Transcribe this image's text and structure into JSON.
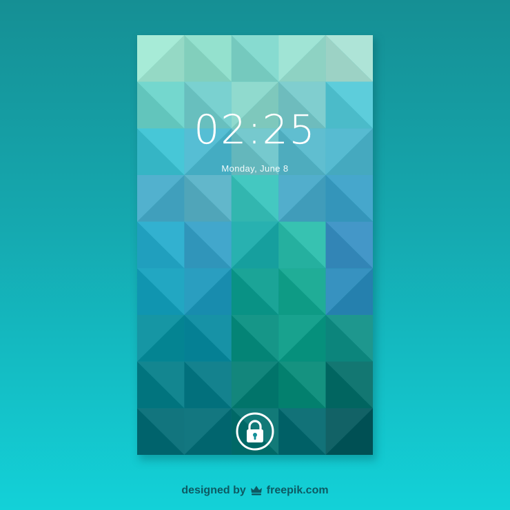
{
  "lock_screen": {
    "time": "02:25",
    "date": "Monday, June 8",
    "unlock_icon": "padlock-icon"
  },
  "credit": {
    "prefix": "designed by",
    "brand": "freepik.com",
    "brand_icon": "freepik-crown-icon"
  },
  "colors": {
    "background_top": "#158f94",
    "background_bottom": "#13d1d8",
    "text": "#ffffff",
    "credit_text": "#0d5a63"
  }
}
